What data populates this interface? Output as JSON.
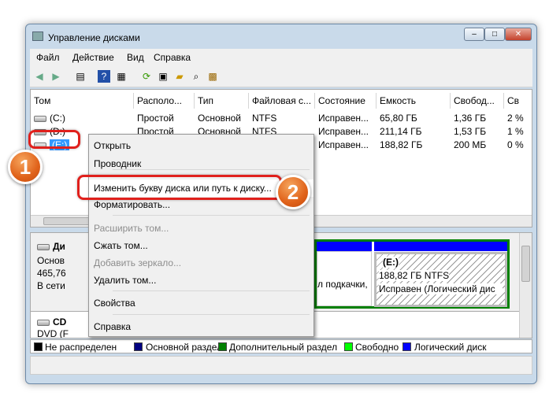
{
  "window": {
    "title": "Управление дисками",
    "min": "–",
    "max": "□",
    "close": "✕"
  },
  "menu": [
    "Файл",
    "Действие",
    "Вид",
    "Справка"
  ],
  "toolbar_icons": [
    "back-icon",
    "forward-icon",
    "console-tree-icon",
    "help-icon",
    "help-topics-icon",
    "refresh-icon",
    "properties-icon",
    "open-icon",
    "search-icon",
    "settings-icon"
  ],
  "columns": [
    "Том",
    "Располо...",
    "Тип",
    "Файловая с...",
    "Состояние",
    "Емкость",
    "Свобод...",
    "Св"
  ],
  "rows": [
    {
      "vol": "(C:)",
      "layout": "Простой",
      "type": "Основной",
      "fs": "NTFS",
      "status": "Исправен...",
      "cap": "65,80 ГБ",
      "free": "1,36 ГБ",
      "pct": "2 %"
    },
    {
      "vol": "(D:)",
      "layout": "Простой",
      "type": "Основной",
      "fs": "NTFS",
      "status": "Исправен...",
      "cap": "211,14 ГБ",
      "free": "1,53 ГБ",
      "pct": "1 %"
    },
    {
      "vol": "(E:)",
      "layout": "",
      "type": "",
      "fs": "",
      "status": "Исправен...",
      "cap": "188,82 ГБ",
      "free": "200 МБ",
      "pct": "0 %"
    }
  ],
  "disks": {
    "disk0": {
      "name": "Ди",
      "type": "Основ",
      "size": "465,76",
      "state": "В сети"
    },
    "middle_partition_text": "л подкачки,",
    "e_partition": {
      "label": "(E:)",
      "size": "188,82 ГБ NTFS",
      "status": "Исправен (Логический дис"
    },
    "cd": {
      "name": "CD",
      "type": "DVD (F"
    }
  },
  "legend": [
    {
      "label": "Не распределен",
      "color": "#000000"
    },
    {
      "label": "Основной раздел",
      "color": "#000080"
    },
    {
      "label": "Дополнительный раздел",
      "color": "#008000"
    },
    {
      "label": "Свободно",
      "color": "#00ff00"
    },
    {
      "label": "Логический диск",
      "color": "#0000ff"
    }
  ],
  "context_menu": [
    {
      "label": "Открыть",
      "enabled": true
    },
    {
      "label": "Проводник",
      "enabled": true
    },
    {
      "label": "Изменить букву диска или путь к диску...",
      "enabled": true
    },
    {
      "label": "Форматировать...",
      "enabled": true
    },
    {
      "label": "Расширить том...",
      "enabled": false
    },
    {
      "label": "Сжать том...",
      "enabled": true
    },
    {
      "label": "Добавить зеркало...",
      "enabled": false
    },
    {
      "label": "Удалить том...",
      "enabled": true
    },
    {
      "label": "Свойства",
      "enabled": true
    },
    {
      "label": "Справка",
      "enabled": true
    }
  ],
  "badges": [
    "1",
    "2"
  ]
}
